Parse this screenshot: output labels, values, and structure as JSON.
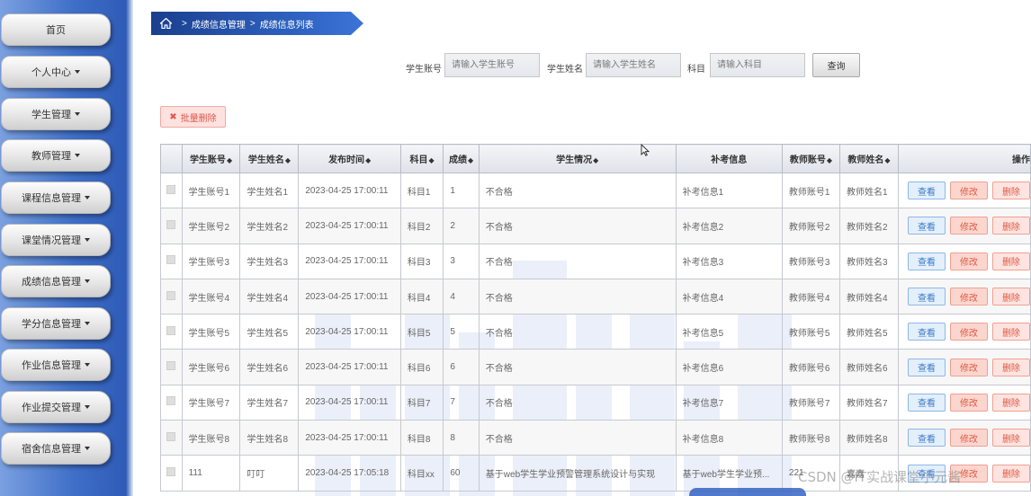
{
  "sidebar": {
    "items": [
      {
        "label": "首页",
        "has_caret": false
      },
      {
        "label": "个人中心",
        "has_caret": true
      },
      {
        "label": "学生管理",
        "has_caret": true
      },
      {
        "label": "教师管理",
        "has_caret": true
      },
      {
        "label": "课程信息管理",
        "has_caret": true
      },
      {
        "label": "课堂情况管理",
        "has_caret": true
      },
      {
        "label": "成绩信息管理",
        "has_caret": true
      },
      {
        "label": "学分信息管理",
        "has_caret": true
      },
      {
        "label": "作业信息管理",
        "has_caret": true
      },
      {
        "label": "作业提交管理",
        "has_caret": true
      },
      {
        "label": "宿舍信息管理",
        "has_caret": true
      }
    ]
  },
  "breadcrumb": {
    "separator": ">",
    "level1": "成绩信息管理",
    "level2": "成绩信息列表"
  },
  "search": {
    "account_label": "学生账号",
    "account_placeholder": "请输入学生账号",
    "name_label": "学生姓名",
    "name_placeholder": "请输入学生姓名",
    "subject_label": "科目",
    "subject_placeholder": "请输入科目",
    "button": "查询"
  },
  "toolbar": {
    "batch_delete": "批量删除"
  },
  "table": {
    "sort_glyph": "◆",
    "headers": [
      "学生账号",
      "学生姓名",
      "发布时间",
      "科目",
      "成绩",
      "学生情况",
      "补考信息",
      "教师账号",
      "教师姓名",
      "操作"
    ],
    "sortable": [
      true,
      true,
      true,
      true,
      true,
      true,
      false,
      true,
      true,
      false
    ],
    "actions": {
      "view": "查看",
      "edit": "修改",
      "delete": "删除"
    },
    "rows": [
      [
        "学生账号1",
        "学生姓名1",
        "2023-04-25 17:00:11",
        "科目1",
        "1",
        "不合格",
        "补考信息1",
        "教师账号1",
        "教师姓名1"
      ],
      [
        "学生账号2",
        "学生姓名2",
        "2023-04-25 17:00:11",
        "科目2",
        "2",
        "不合格",
        "补考信息2",
        "教师账号2",
        "教师姓名2"
      ],
      [
        "学生账号3",
        "学生姓名3",
        "2023-04-25 17:00:11",
        "科目3",
        "3",
        "不合格",
        "补考信息3",
        "教师账号3",
        "教师姓名3"
      ],
      [
        "学生账号4",
        "学生姓名4",
        "2023-04-25 17:00:11",
        "科目4",
        "4",
        "不合格",
        "补考信息4",
        "教师账号4",
        "教师姓名4"
      ],
      [
        "学生账号5",
        "学生姓名5",
        "2023-04-25 17:00:11",
        "科目5",
        "5",
        "不合格",
        "补考信息5",
        "教师账号5",
        "教师姓名5"
      ],
      [
        "学生账号6",
        "学生姓名6",
        "2023-04-25 17:00:11",
        "科目6",
        "6",
        "不合格",
        "补考信息6",
        "教师账号6",
        "教师姓名6"
      ],
      [
        "学生账号7",
        "学生姓名7",
        "2023-04-25 17:00:11",
        "科目7",
        "7",
        "不合格",
        "补考信息7",
        "教师账号7",
        "教师姓名7"
      ],
      [
        "学生账号8",
        "学生姓名8",
        "2023-04-25 17:00:11",
        "科目8",
        "8",
        "不合格",
        "补考信息8",
        "教师账号8",
        "教师姓名8"
      ],
      [
        "111",
        "叮叮",
        "2023-04-25 17:05:18",
        "科目xx",
        "60",
        "基于web学生学业预警管理系统设计与实现",
        "基于web学生学业预...",
        "221",
        "嘉嘉"
      ]
    ]
  },
  "watermark": "CSDN @IT实战课堂小元酱",
  "colors": {
    "sidebar": "#3f6fc8",
    "breadcrumb": "#2e63c2",
    "view_button": "#3c7ac6",
    "edit_button": "#e05a44"
  }
}
